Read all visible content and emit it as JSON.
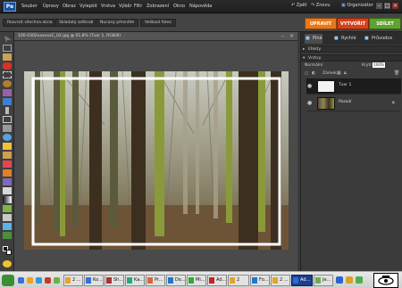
{
  "app": {
    "logo": "Pe"
  },
  "menu": {
    "items": [
      "Soubor",
      "Úpravy",
      "Obraz",
      "Vylepšit",
      "Vrstva",
      "Výběr",
      "Filtr",
      "Zobrazení",
      "Okno",
      "Nápověda"
    ]
  },
  "top_actions": {
    "undo": "Zpět",
    "redo": "Znovu",
    "organizer": "Organizátor"
  },
  "bar2": {
    "tabs": [
      "Rozvrsit všechna okna",
      "Skladatý seškrob",
      "Nucaný přesněte",
      "Velikost fotec"
    ]
  },
  "modes": [
    {
      "label": "UPRAVIT",
      "color": "#e8781b"
    },
    {
      "label": "VYTVOŘIT",
      "color": "#d4421d"
    },
    {
      "label": "SDÍLET",
      "color": "#5ea32f"
    }
  ],
  "document": {
    "title": "100-0302xxxxxxC_02.jpg @ 61,8% (Tvar 1, RGB/8)"
  },
  "panel": {
    "tabs": [
      "Plné",
      "Rychlé",
      "Průvodce"
    ],
    "effects_header": "Efekty",
    "layers_header": "Vrstvy",
    "blend_mode": "Normální",
    "opacity_label": "Krytí:",
    "opacity_value": "100%",
    "lock_label": "Zámek:",
    "layers": [
      {
        "name": "Tvar 1",
        "selected": true
      },
      {
        "name": "Pozadí",
        "selected": false
      }
    ]
  },
  "taskbar": {
    "start": "Start",
    "buttons": [
      {
        "label": "2 ...",
        "active": false
      },
      {
        "label": "Ko...",
        "active": false
      },
      {
        "label": "Sh...",
        "active": false
      },
      {
        "label": "Ka...",
        "active": false
      },
      {
        "label": "Pr...",
        "active": false
      },
      {
        "label": "Do...",
        "active": false
      },
      {
        "label": "Mi...",
        "active": false
      },
      {
        "label": "Ad...",
        "active": false
      },
      {
        "label": "2 W...",
        "active": false
      },
      {
        "label": "Fo...",
        "active": false
      },
      {
        "label": "2 ...",
        "active": false
      },
      {
        "label": "Ad...",
        "active": true
      },
      {
        "label": "Je...",
        "active": false
      }
    ],
    "tray_icon": "camera-icon"
  },
  "colors": {
    "accent_blue": "#1b3f8b",
    "panel_bg": "#3b3b3b"
  }
}
